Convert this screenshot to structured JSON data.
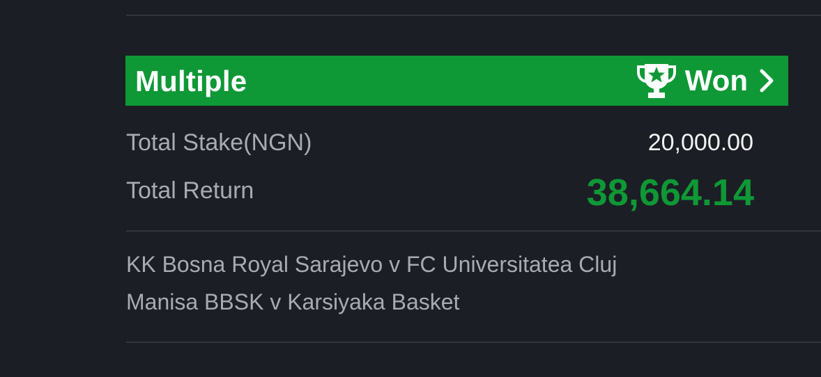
{
  "bet": {
    "type": "Multiple",
    "status": "Won",
    "status_icon": "trophy-star-icon",
    "chevron_icon": "chevron-right-icon",
    "header_color": "#0f9836"
  },
  "summary": {
    "stake_label": "Total Stake(NGN)",
    "stake_value": "20,000.00",
    "return_label": "Total Return",
    "return_value": "38,664.14",
    "return_color": "#0f9836"
  },
  "matches": [
    "KK Bosna Royal Sarajevo v FC Universitatea Cluj",
    "Manisa BBSK v Karsiyaka Basket"
  ]
}
